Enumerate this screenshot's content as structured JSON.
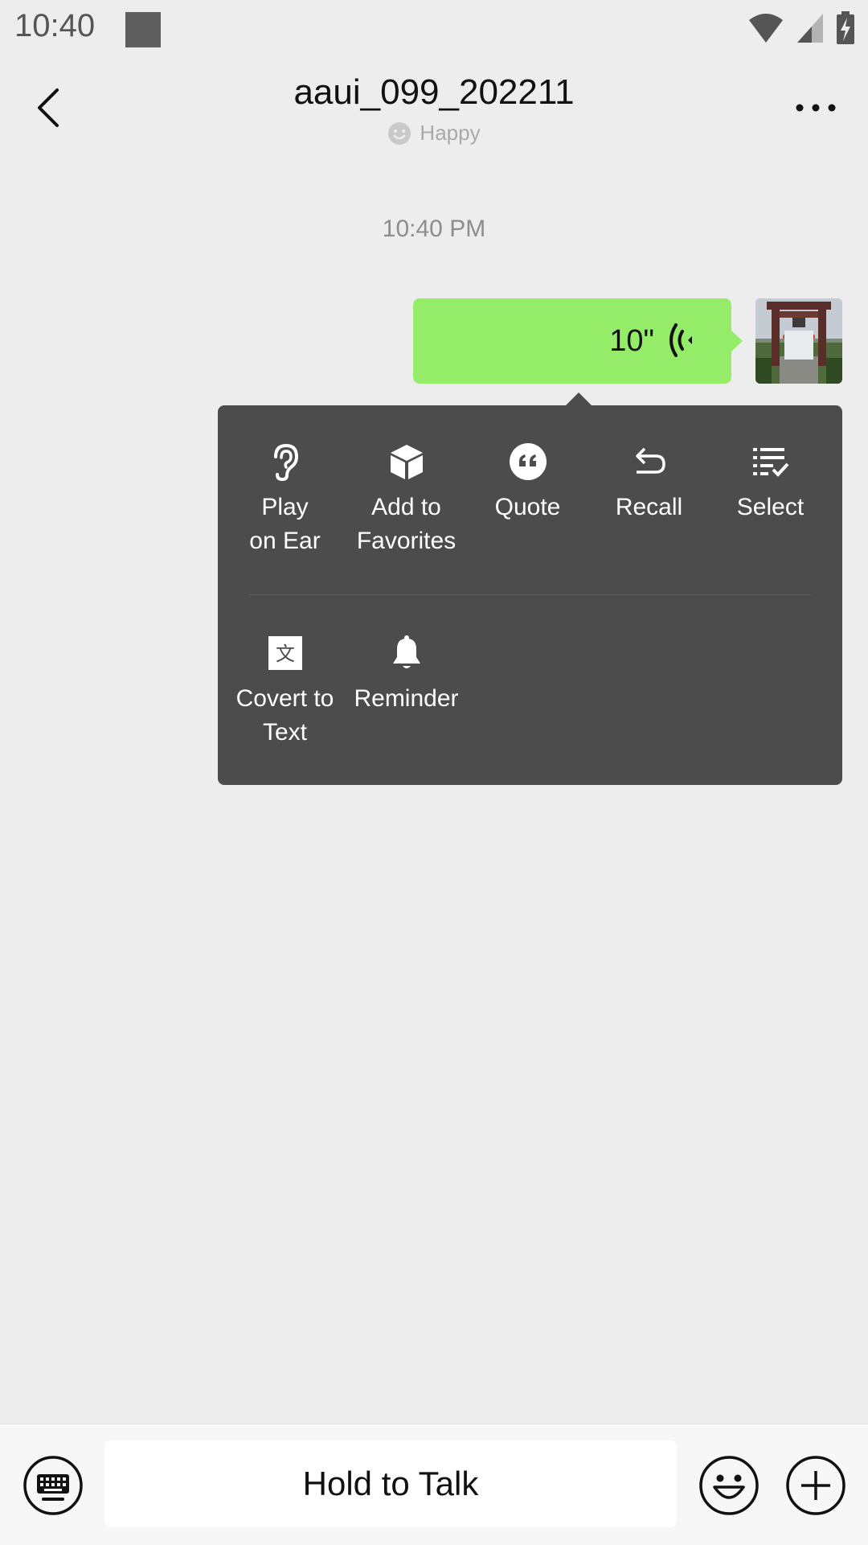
{
  "status_bar": {
    "time": "10:40"
  },
  "header": {
    "title": "aaui_099_202211",
    "status": "Happy"
  },
  "chat": {
    "timestamp": "10:40 PM",
    "voice_message": {
      "duration": "10\""
    }
  },
  "context_menu": {
    "items": [
      {
        "label": "Play\non Ear",
        "icon": "ear-icon"
      },
      {
        "label": "Add to\nFavorites",
        "icon": "cube-icon"
      },
      {
        "label": "Quote",
        "icon": "quote-icon"
      },
      {
        "label": "Recall",
        "icon": "undo-icon"
      },
      {
        "label": "Select",
        "icon": "checklist-icon"
      },
      {
        "label": "Covert to\nText",
        "icon": "translate-icon"
      },
      {
        "label": "Reminder",
        "icon": "bell-icon"
      }
    ]
  },
  "bottom_bar": {
    "hold_to_talk": "Hold to Talk"
  },
  "colors": {
    "background": "#ededed",
    "bubble_green": "#95ec69",
    "menu_bg": "#4c4c4c"
  }
}
